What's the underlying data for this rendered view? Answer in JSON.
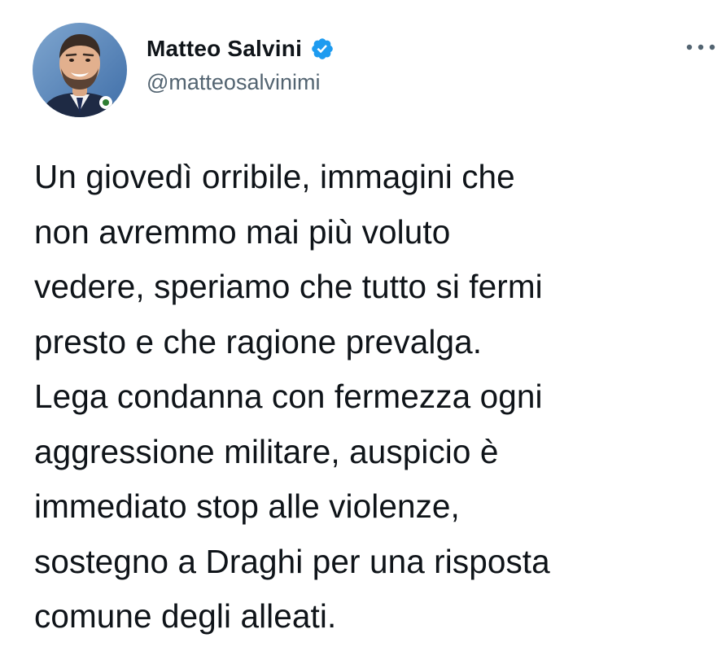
{
  "author": {
    "display_name": "Matteo Salvini",
    "handle": "@matteosalvinimi",
    "verified": true,
    "verified_color": "#1d9bf0",
    "avatar_icon": "profile-photo"
  },
  "tweet": {
    "lines": [
      "Un giovedì orribile, immagini che",
      "non avremmo mai più voluto",
      "vedere, speriamo che tutto si fermi",
      "presto e che ragione prevalga.",
      "Lega condanna con fermezza ogni",
      "aggressione militare, auspicio è",
      "immediato stop alle violenze,",
      "sostegno a Draghi per una risposta",
      "comune degli alleati."
    ]
  },
  "more_menu_icon": "more-horizontal-icon",
  "colors": {
    "text_primary": "#0f1419",
    "text_secondary": "#536471",
    "background": "#ffffff"
  }
}
